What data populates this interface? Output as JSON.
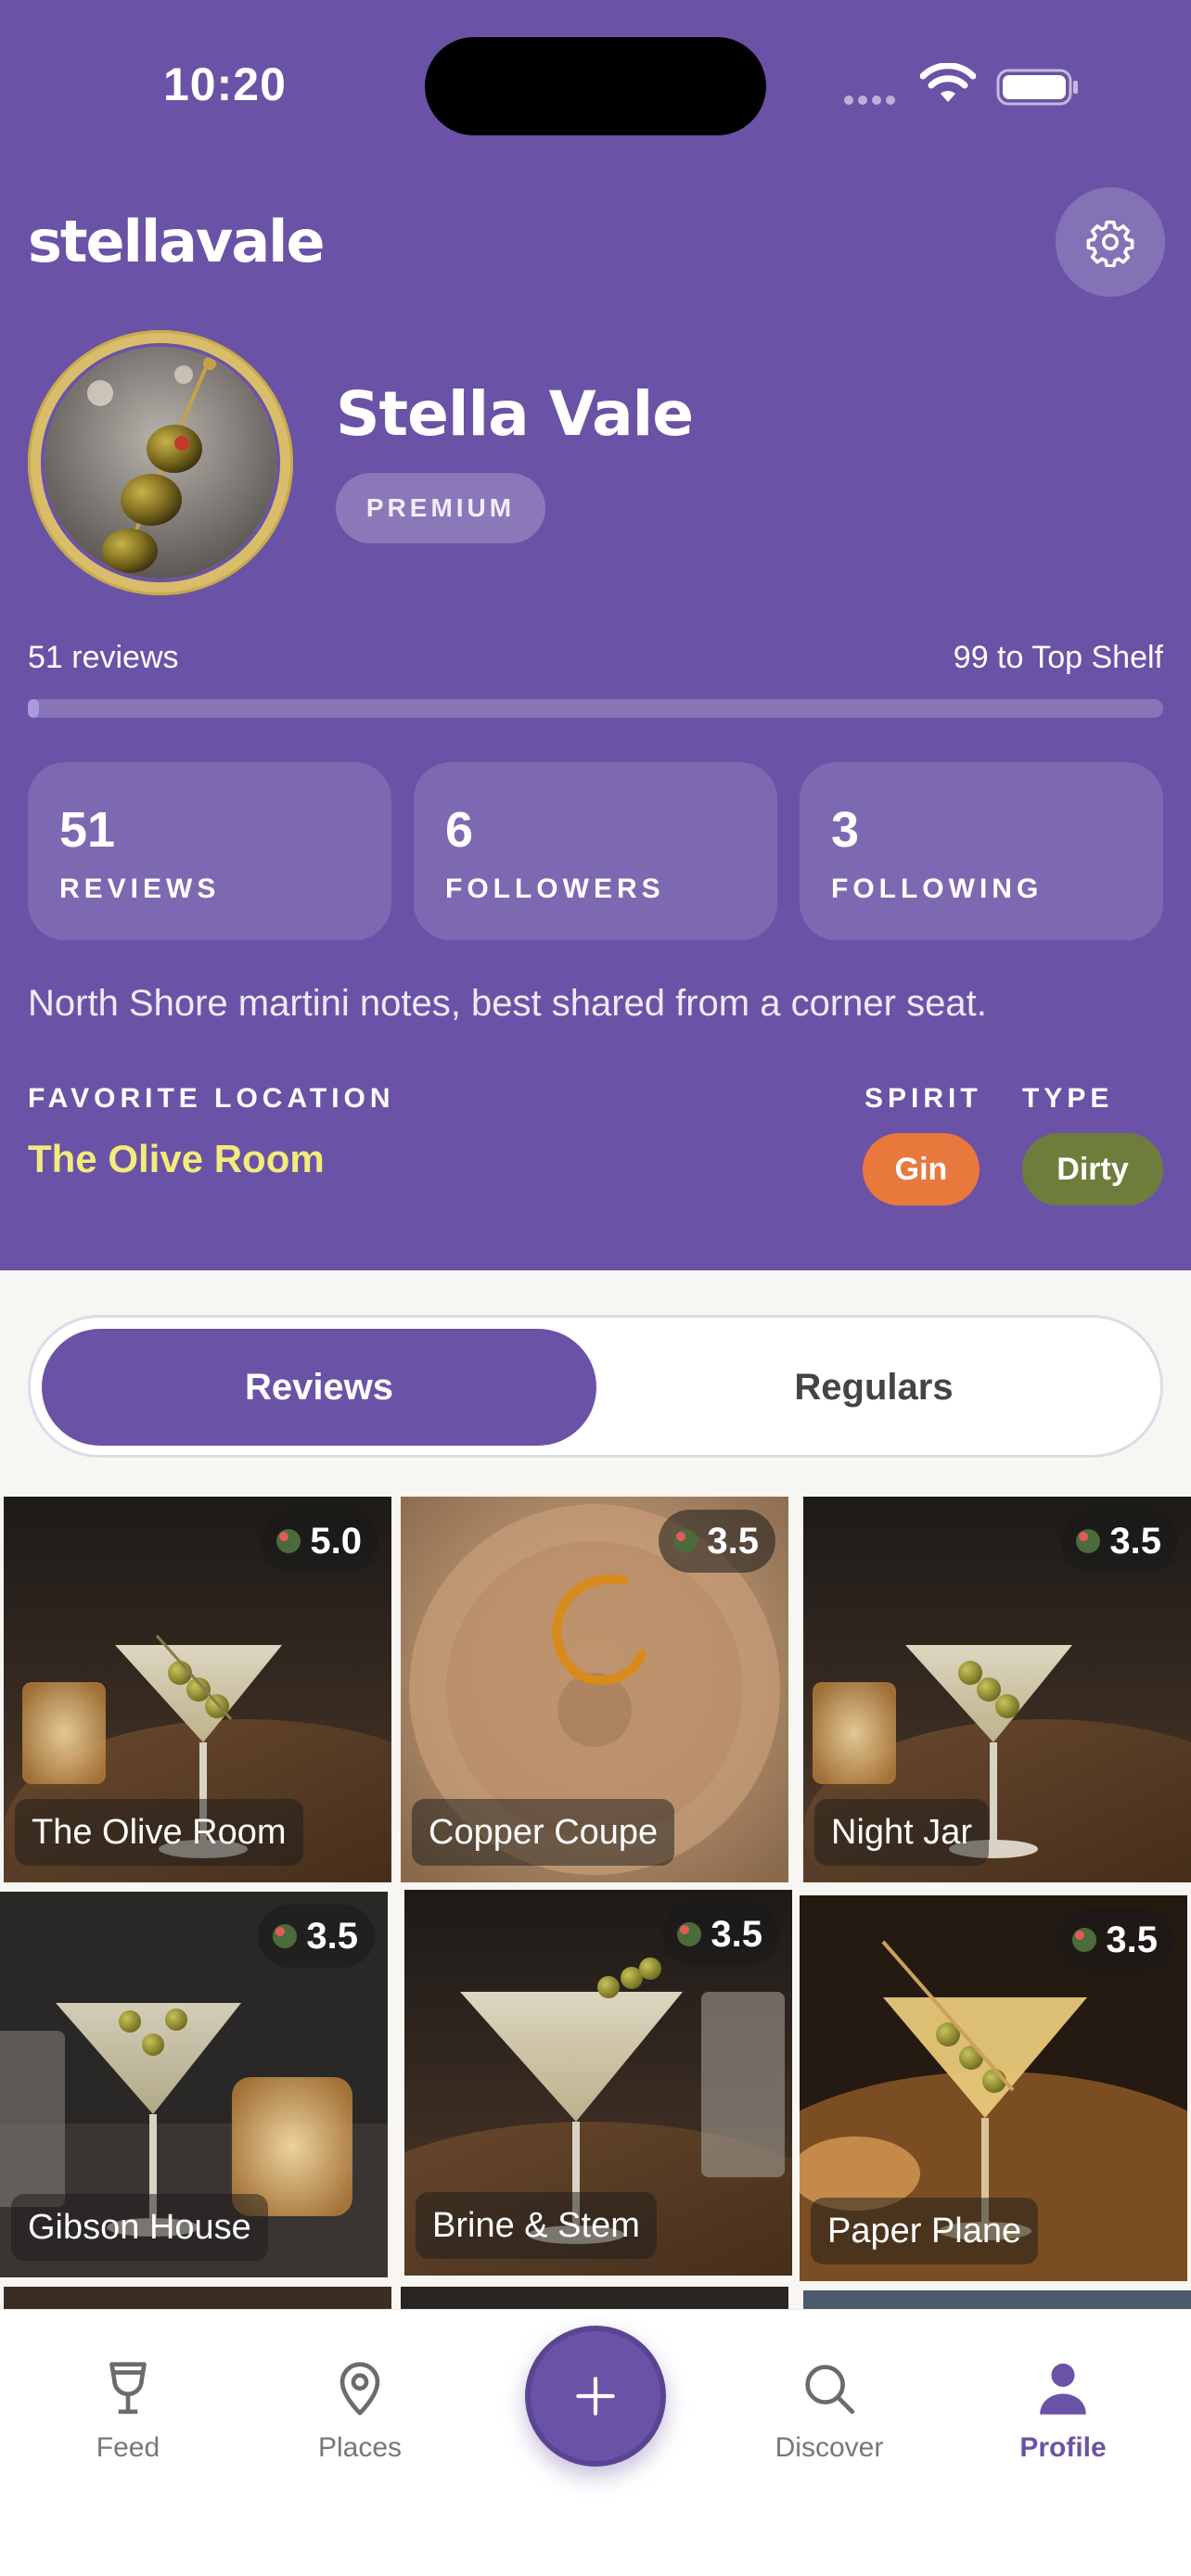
{
  "status_bar": {
    "time": "10:20"
  },
  "app": {
    "brand": "stellavale"
  },
  "profile": {
    "name": "Stella Vale",
    "badge": "PREMIUM",
    "reviews_count_label": "51 reviews",
    "next_level_label": "99 to Top Shelf",
    "level_progress": 0.01,
    "bio": "North Shore martini notes, best shared from a corner seat."
  },
  "stats": [
    {
      "value": "51",
      "label": "REVIEWS"
    },
    {
      "value": "6",
      "label": "FOLLOWERS"
    },
    {
      "value": "3",
      "label": "FOLLOWING"
    }
  ],
  "preferences": {
    "favorite_location_label": "FAVORITE LOCATION",
    "favorite_location": "The Olive Room",
    "spirit_label": "SPIRIT",
    "spirit": "Gin",
    "type_label": "TYPE",
    "type": "Dirty"
  },
  "segmented": {
    "reviews": "Reviews",
    "regulars": "Regulars",
    "selected": "Reviews"
  },
  "reviews": [
    {
      "place": "The Olive Room",
      "rating": "5.0"
    },
    {
      "place": "Copper Coupe",
      "rating": "3.5"
    },
    {
      "place": "Night Jar",
      "rating": "3.5"
    },
    {
      "place": "Gibson House",
      "rating": "3.5"
    },
    {
      "place": "Brine & Stem",
      "rating": "3.5"
    },
    {
      "place": "Paper Plane",
      "rating": "3.5"
    }
  ],
  "tabbar": {
    "feed": "Feed",
    "places": "Places",
    "discover": "Discover",
    "profile": "Profile",
    "active": "Profile"
  },
  "colors": {
    "brand_purple": "#6a53a6",
    "gin": "#e9783c",
    "dirty": "#6f7d3c",
    "favorite": "#f3eb7a"
  }
}
